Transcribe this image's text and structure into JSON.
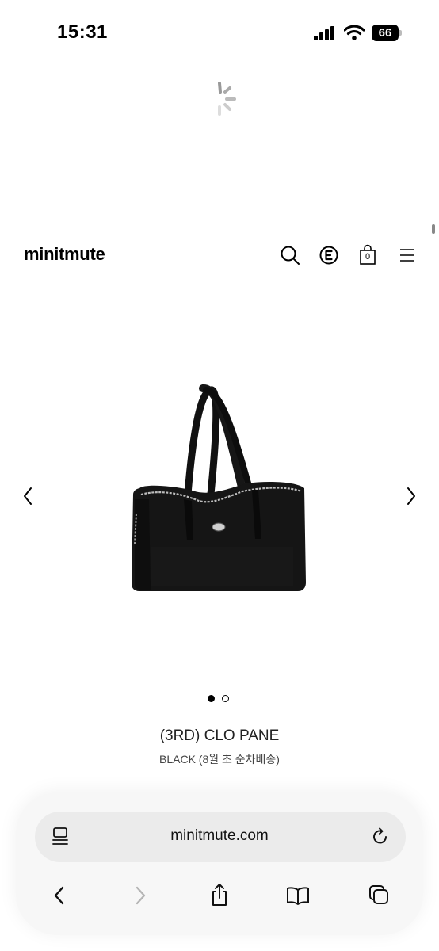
{
  "status_bar": {
    "time": "15:31",
    "battery": "66"
  },
  "site": {
    "logo": "minitmute",
    "icons": [
      "search-icon",
      "e-circle-icon",
      "cart-icon",
      "menu-icon"
    ],
    "cart_count": "0"
  },
  "carousel": {
    "total_images": 2,
    "active_index": 1
  },
  "product": {
    "name": "(3RD) CLO PANE",
    "variant": "BLACK (8월 초 순차배송)"
  },
  "browser": {
    "url": "minitmute.com",
    "toolbar_icons": [
      "back-icon",
      "forward-icon",
      "share-icon",
      "bookmarks-icon",
      "tabs-icon"
    ]
  },
  "colors": {
    "background": "#ffffff",
    "text": "#111111",
    "browser_bar": "#f7f7f7",
    "url_pill": "#ebebeb"
  }
}
